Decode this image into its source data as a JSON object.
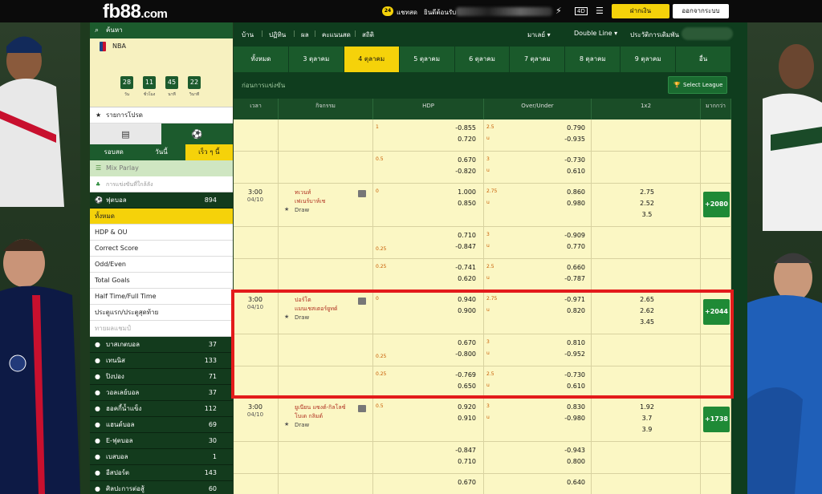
{
  "header": {
    "logo": "fb88",
    "logo_suffix": ".com",
    "chat_badge": "24",
    "chat_label": "แชทสด",
    "welcome": "ยินดีต้อนรับ",
    "deposit": "ฝากเงิน",
    "logout": "ออกจากระบบ",
    "promo_badge": "4D"
  },
  "sidebar": {
    "search_label": "ค้นหา",
    "nba_label": "NBA",
    "countdown": [
      {
        "value": "28",
        "unit": "วัน"
      },
      {
        "value": "11",
        "unit": "ชั่วโมง"
      },
      {
        "value": "45",
        "unit": "นาที"
      },
      {
        "value": "22",
        "unit": "วินาที"
      }
    ],
    "favorites": "รายการโปรด",
    "period_tabs": [
      "รอบสด",
      "วันนี้",
      "เร็ว ๆ นี้"
    ],
    "mix_parlay": "Mix Parlay",
    "live_matches": "การแข่งขันที่ใกล้ลัง",
    "football_label": "ฟุตบอล",
    "football_count": "894",
    "football_subs": [
      "ทั้งหมด",
      "HDP & OU",
      "Correct Score",
      "Odd/Even",
      "Total Goals",
      "Half Time/Full Time",
      "ประตูแรก/ประตูสุดท้าย",
      "ทายผลแชมป์"
    ],
    "sports": [
      {
        "name": "บาสเกตบอล",
        "count": "37"
      },
      {
        "name": "เทนนิส",
        "count": "133"
      },
      {
        "name": "ปิงปอง",
        "count": "71"
      },
      {
        "name": "วอลเลย์บอล",
        "count": "37"
      },
      {
        "name": "ฮอคกี้น้ำแข็ง",
        "count": "112"
      },
      {
        "name": "แฮนด์บอล",
        "count": "69"
      },
      {
        "name": "E-ฟุตบอล",
        "count": "30"
      },
      {
        "name": "เบสบอล",
        "count": "1"
      },
      {
        "name": "อีสปอร์ต",
        "count": "143"
      },
      {
        "name": "ศิลปะการต่อสู้",
        "count": "60"
      }
    ]
  },
  "main": {
    "nav": [
      "บ้าน",
      "ปฏิทิน",
      "ผล",
      "คะแนนสด",
      "สถิติ"
    ],
    "market": "มาเลย์",
    "line_type": "Double Line",
    "history": "ประวัติการเดิมพัน",
    "dates": [
      "ทั้งหมด",
      "3 ตุลาคม",
      "4 ตุลาคม",
      "5 ตุลาคม",
      "6 ตุลาคม",
      "7 ตุลาคม",
      "8 ตุลาคม",
      "9 ตุลาคม",
      "อื่น"
    ],
    "section_title": "ก่อนการแข่งขัน",
    "select_league": "Select League",
    "columns": [
      "เวลา",
      "กิจกรรม",
      "HDP",
      "Over/Under",
      "1x2",
      "มากกว่า"
    ]
  },
  "matches": [
    {
      "time": "",
      "date": "",
      "home": "",
      "away": "",
      "draw": "",
      "more": "",
      "x12": [],
      "lines": [
        {
          "hdp_line": "1",
          "hdp_home": "-0.855",
          "hdp_away": "0.720",
          "ou_line": "2.5",
          "ou_u": "u",
          "ou_over": "0.790",
          "ou_under": "-0.935"
        },
        {
          "hdp_line": "0.5",
          "hdp_home": "0.670",
          "hdp_away": "-0.820",
          "ou_line": "3",
          "ou_u": "u",
          "ou_over": "-0.730",
          "ou_under": "0.610"
        }
      ]
    },
    {
      "time": "3:00",
      "date": "04/10",
      "home": "ทเวนท์",
      "away": "เฟเนร์บาห์เช",
      "draw": "Draw",
      "more": "+2080",
      "x12": [
        "2.75",
        "2.52",
        "3.5"
      ],
      "lines": [
        {
          "hdp_line": "0",
          "hdp_home": "1.000",
          "hdp_away": "0.850",
          "ou_line": "2.75",
          "ou_u": "u",
          "ou_over": "0.860",
          "ou_under": "0.980"
        },
        {
          "hdp_line": "0.25",
          "hdp_home": "0.710",
          "hdp_away": "-0.847",
          "ou_line": "3",
          "ou_u": "u",
          "ou_over": "-0.909",
          "ou_under": "0.770"
        },
        {
          "hdp_line": "0.25",
          "hdp_home": "-0.741",
          "hdp_away": "0.620",
          "ou_line": "2.5",
          "ou_u": "u",
          "ou_over": "0.660",
          "ou_under": "-0.787"
        }
      ]
    },
    {
      "time": "3:00",
      "date": "04/10",
      "home": "ปอร์โต",
      "away": "แมนเชสเตอร์ยูทด์",
      "draw": "Draw",
      "more": "+2044",
      "x12": [
        "2.65",
        "2.62",
        "3.45"
      ],
      "lines": [
        {
          "hdp_line": "0",
          "hdp_home": "0.940",
          "hdp_away": "0.900",
          "ou_line": "2.75",
          "ou_u": "u",
          "ou_over": "-0.971",
          "ou_under": "0.820"
        },
        {
          "hdp_line": "0.25",
          "hdp_home": "0.670",
          "hdp_away": "-0.800",
          "ou_line": "3",
          "ou_u": "u",
          "ou_over": "0.810",
          "ou_under": "-0.952"
        },
        {
          "hdp_line": "0.25",
          "hdp_home": "-0.769",
          "hdp_away": "0.650",
          "ou_line": "2.5",
          "ou_u": "u",
          "ou_over": "-0.730",
          "ou_under": "0.610"
        }
      ]
    },
    {
      "time": "3:00",
      "date": "04/10",
      "home": "ยูเนียน แซงต์-กิลโลซ์",
      "away": "โบเด กลิมต์",
      "draw": "Draw",
      "more": "+1738",
      "x12": [
        "1.92",
        "3.7",
        "3.9"
      ],
      "lines": [
        {
          "hdp_line": "0.5",
          "hdp_home": "0.920",
          "hdp_away": "0.910",
          "ou_line": "3",
          "ou_u": "u",
          "ou_over": "0.830",
          "ou_under": "-0.980"
        },
        {
          "hdp_line": "",
          "hdp_home": "-0.847",
          "hdp_away": "0.710",
          "ou_line": "",
          "ou_u": "",
          "ou_over": "-0.943",
          "ou_under": "0.800"
        },
        {
          "hdp_line": "",
          "hdp_home": "0.670",
          "hdp_away": "",
          "ou_line": "",
          "ou_u": "",
          "ou_over": "0.640",
          "ou_under": ""
        }
      ]
    }
  ]
}
